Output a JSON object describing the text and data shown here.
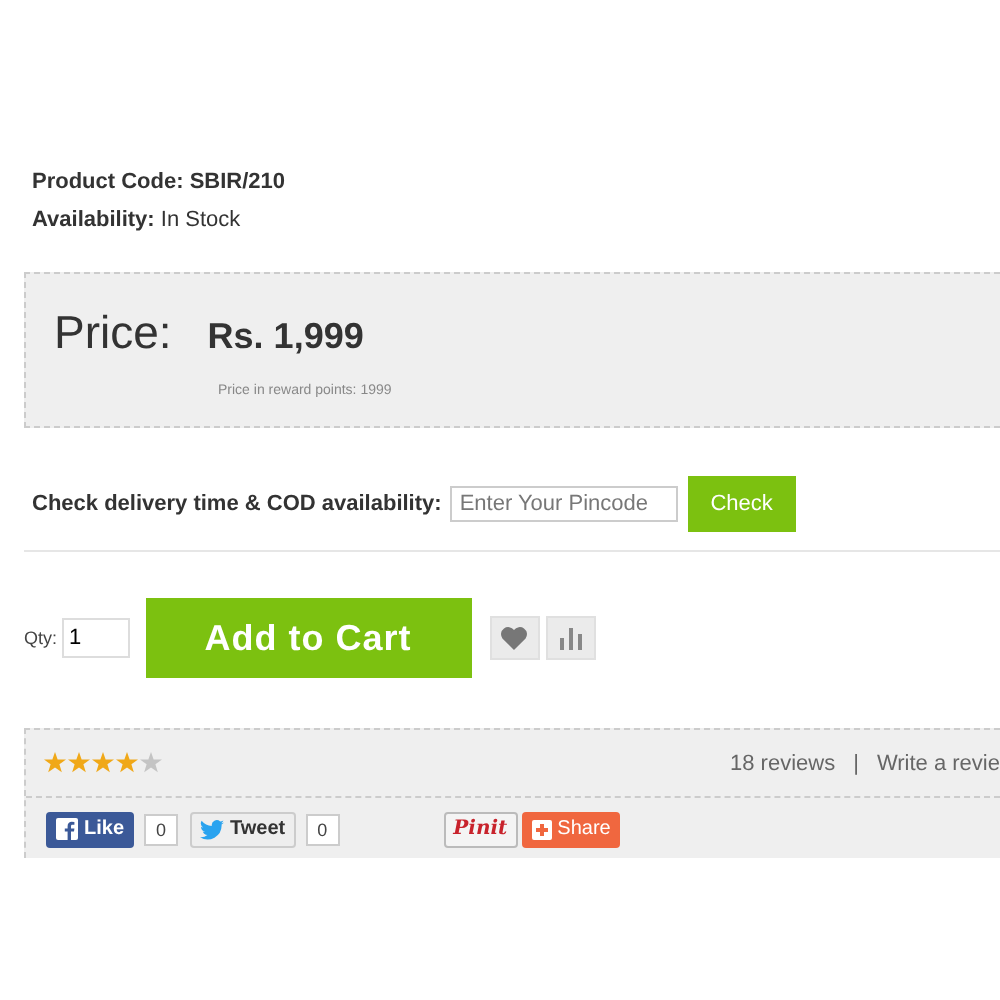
{
  "product": {
    "code": "Product Code: SBIR/210",
    "availability": "**Availability:** In Stock"
  },
  "price": {
    "label": "Price:",
    "amount": "Rs. 1,999",
    "reward": "Price in reward points: 1999"
  },
  "delivery": {
    "label": "Check delivery time & COD availability:",
    "placeholder": "Enter Your Pincode",
    "button": "Check"
  },
  "cart": {
    "qty_label": "Qty:",
    "qty": "1",
    "button": "Add to Cart"
  },
  "rating": {
    "stars": 4,
    "reviews": "18 reviews",
    "separator": "|",
    "write": "Write a revie"
  },
  "social": [
    {
      "kind": "like",
      "label": "Like",
      "count": "0"
    },
    {
      "kind": "tweet",
      "label": "Tweet",
      "count": "0"
    },
    {
      "kind": "pin",
      "label": "Pinit"
    },
    {
      "kind": "share",
      "label": "Share"
    }
  ]
}
